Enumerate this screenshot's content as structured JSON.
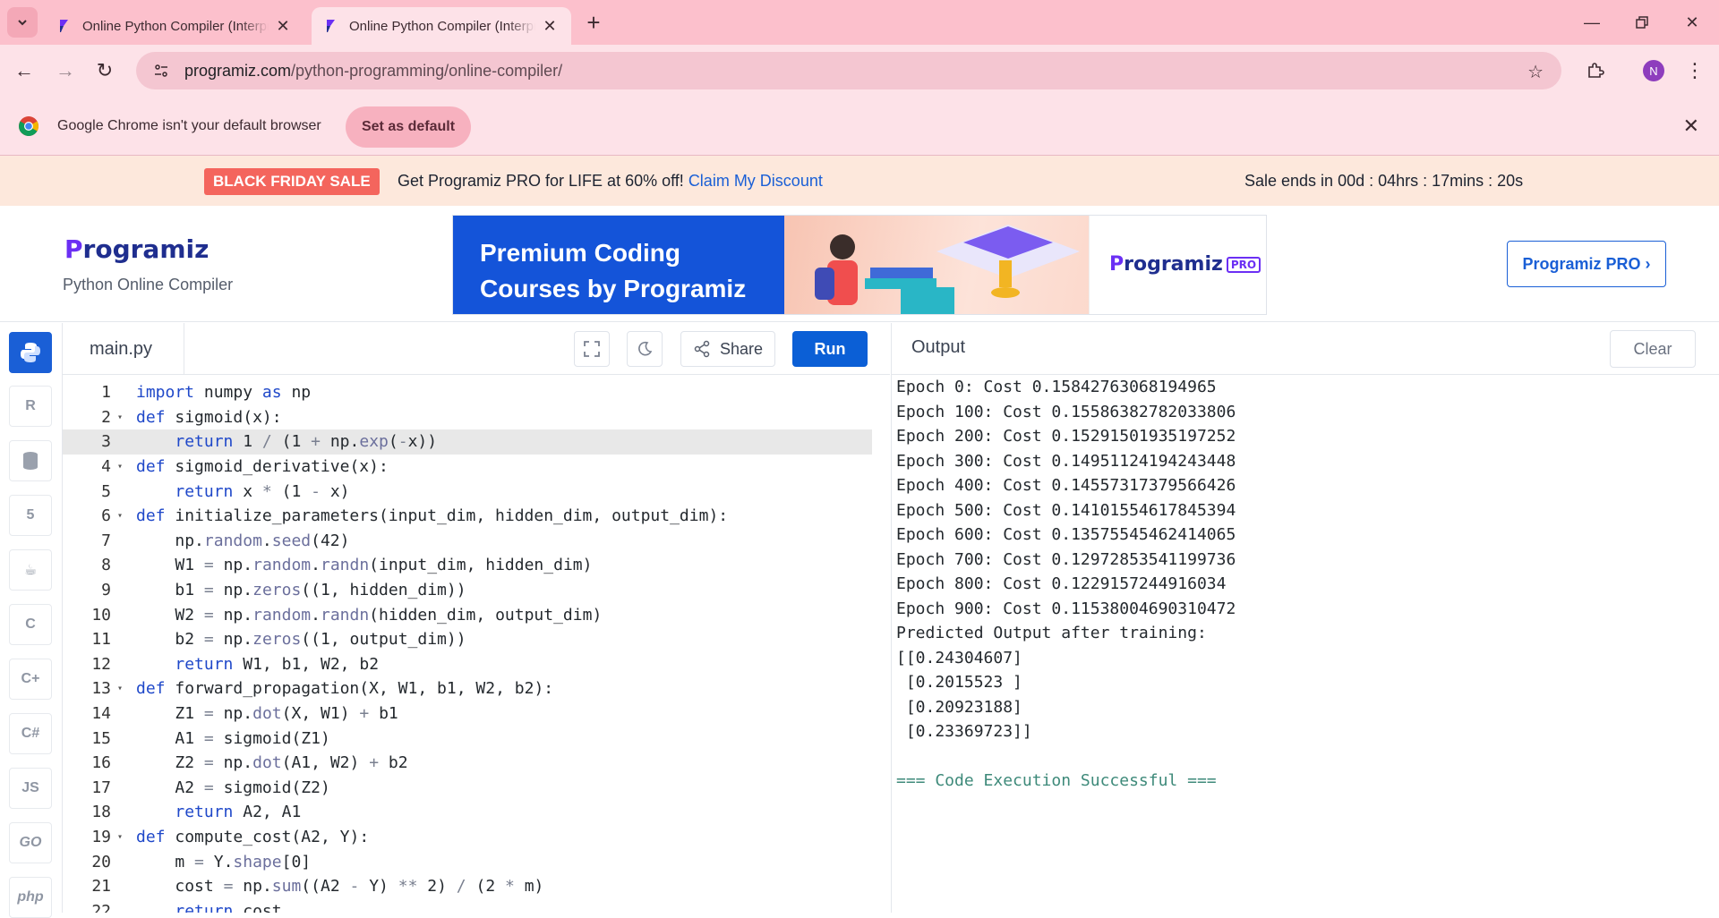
{
  "browser": {
    "tabs": [
      {
        "title": "Online Python Compiler (Interpreter)",
        "active": false
      },
      {
        "title": "Online Python Compiler (Interpreter)",
        "active": true
      }
    ],
    "url_host": "programiz.com",
    "url_path": "/python-programming/online-compiler/",
    "profile_initial": "N"
  },
  "infobar": {
    "message": "Google Chrome isn't your default browser",
    "button": "Set as default"
  },
  "promo": {
    "badge": "BLACK FRIDAY SALE",
    "offer": "Get Programiz PRO for LIFE at 60% off!",
    "link": "Claim My Discount",
    "timer": "Sale ends in 00d : 04hrs : 17mins : 20s"
  },
  "header": {
    "logo_p": "P",
    "logo_rest": "rogramiz",
    "subtitle": "Python Online Compiler",
    "ad_title_1": "Premium Coding",
    "ad_title_2": "Courses by Programiz",
    "ad_logo": "rogramiz",
    "ad_pro": "PRO",
    "pro_button": "Programiz PRO ›"
  },
  "languages": [
    "python",
    "r",
    "sql",
    "html",
    "java",
    "c",
    "cpp",
    "csharp",
    "JS",
    "GO",
    "php"
  ],
  "editor": {
    "filename": "main.py",
    "share_label": "Share",
    "run_label": "Run",
    "active_line": 3,
    "lines": [
      "import numpy as np",
      "def sigmoid(x):",
      "    return 1 / (1 + np.exp(-x))",
      "def sigmoid_derivative(x):",
      "    return x * (1 - x)",
      "def initialize_parameters(input_dim, hidden_dim, output_dim):",
      "    np.random.seed(42)",
      "    W1 = np.random.randn(input_dim, hidden_dim)",
      "    b1 = np.zeros((1, hidden_dim))",
      "    W2 = np.random.randn(hidden_dim, output_dim)",
      "    b2 = np.zeros((1, output_dim))",
      "    return W1, b1, W2, b2",
      "def forward_propagation(X, W1, b1, W2, b2):",
      "    Z1 = np.dot(X, W1) + b1",
      "    A1 = sigmoid(Z1)",
      "    Z2 = np.dot(A1, W2) + b2",
      "    A2 = sigmoid(Z2)",
      "    return A2, A1",
      "def compute_cost(A2, Y):",
      "    m = Y.shape[0]",
      "    cost = np.sum((A2 - Y) ** 2) / (2 * m)",
      "    return cost"
    ],
    "fold_lines": [
      2,
      4,
      6,
      13,
      19
    ]
  },
  "output": {
    "title": "Output",
    "clear_label": "Clear",
    "lines": [
      "Epoch 0: Cost 0.15842763068194965",
      "Epoch 100: Cost 0.15586382782033806",
      "Epoch 200: Cost 0.15291501935197252",
      "Epoch 300: Cost 0.14951124194243448",
      "Epoch 400: Cost 0.14557317379566426",
      "Epoch 500: Cost 0.14101554617845394",
      "Epoch 600: Cost 0.13575545462414065",
      "Epoch 700: Cost 0.12972853541199736",
      "Epoch 800: Cost 0.1229157244916034",
      "Epoch 900: Cost 0.11538004690310472",
      "Predicted Output after training:",
      "[[0.24304607]",
      " [0.2015523 ]",
      " [0.20923188]",
      " [0.23369723]]",
      ""
    ],
    "status": "=== Code Execution Successful ==="
  }
}
